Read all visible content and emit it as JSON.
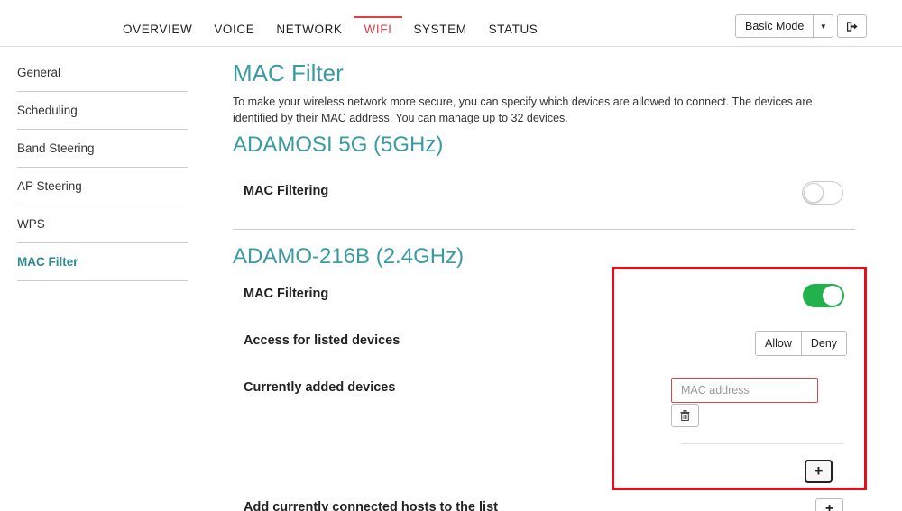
{
  "nav": {
    "items": [
      "OVERVIEW",
      "VOICE",
      "NETWORK",
      "WIFI",
      "SYSTEM",
      "STATUS"
    ],
    "active": "WIFI",
    "mode_label": "Basic Mode"
  },
  "sidebar": {
    "items": [
      {
        "label": "General"
      },
      {
        "label": "Scheduling"
      },
      {
        "label": "Band Steering"
      },
      {
        "label": "AP Steering"
      },
      {
        "label": "WPS"
      },
      {
        "label": "MAC Filter",
        "active": true
      }
    ]
  },
  "main": {
    "title": "MAC Filter",
    "description": "To make your wireless network more secure, you can specify which devices are allowed to connect. The devices are identified by their MAC address. You can manage up to 32 devices.",
    "sections": [
      {
        "title": "ADAMOSI 5G (5GHz)",
        "mac_filtering_label": "MAC Filtering",
        "mac_filtering_enabled": false
      },
      {
        "title": "ADAMO-216B (2.4GHz)",
        "mac_filtering_label": "MAC Filtering",
        "mac_filtering_enabled": true,
        "access_label": "Access for listed devices",
        "access_options": [
          "Allow",
          "Deny"
        ],
        "devices_label": "Currently added devices",
        "mac_placeholder": "MAC address",
        "add_hosts_label": "Add currently connected hosts to the list"
      }
    ]
  },
  "colors": {
    "accent": "#3a9ba3",
    "active_nav": "#e0404a",
    "toggle_on": "#22b14c",
    "highlight": "#e3101b"
  }
}
